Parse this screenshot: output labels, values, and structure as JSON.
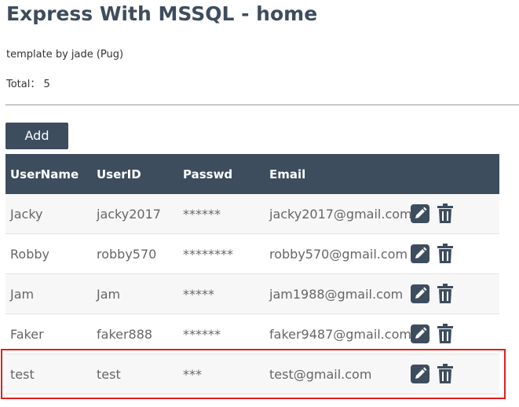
{
  "page": {
    "title": "Express With MSSQL - home",
    "subtitle": "template by jade (Pug)",
    "total_label": "Total：",
    "total_value": "5"
  },
  "toolbar": {
    "add_label": "Add"
  },
  "table": {
    "headers": [
      "UserName",
      "UserID",
      "Passwd",
      "Email"
    ],
    "rows": [
      {
        "username": "Jacky",
        "userid": "jacky2017",
        "passwd": "******",
        "email": "jacky2017@gmail.com"
      },
      {
        "username": "Robby",
        "userid": "robby570",
        "passwd": "********",
        "email": "robby570@gmail.com"
      },
      {
        "username": "Jam",
        "userid": "Jam",
        "passwd": "*****",
        "email": "jam1988@gmail.com"
      },
      {
        "username": "Faker",
        "userid": "faker888",
        "passwd": "******",
        "email": "faker9487@gmail.com"
      },
      {
        "username": "test",
        "userid": "test",
        "passwd": "***",
        "email": "test@gmail.com"
      }
    ]
  },
  "icons": {
    "edit": "pencil-edit-icon",
    "delete": "trash-icon"
  },
  "colors": {
    "header_bg": "#3d4d5e",
    "highlight": "#e0201c"
  }
}
